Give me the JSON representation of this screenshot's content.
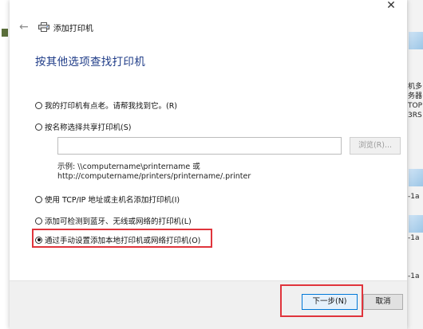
{
  "window": {
    "close_glyph": "✕",
    "back_glyph": "←",
    "title": "添加打印机",
    "heading": "按其他选项查找打印机"
  },
  "options": [
    {
      "label": "我的打印机有点老。请帮我找到它。(R)",
      "checked": false
    },
    {
      "label": "按名称选择共享打印机(S)",
      "checked": false
    },
    {
      "label": "使用 TCP/IP 地址或主机名添加打印机(I)",
      "checked": false
    },
    {
      "label": "添加可检测到蓝牙、无线或网络的打印机(L)",
      "checked": false
    },
    {
      "label": "通过手动设置添加本地打印机或网络打印机(O)",
      "checked": true
    }
  ],
  "share": {
    "input_value": "",
    "browse_label": "浏览(R)...",
    "example_line1": "示例: \\\\computername\\printername 或",
    "example_line2": "http://computername/printers/printername/.printer"
  },
  "buttons": {
    "next": "下一步(N)",
    "cancel": "取消"
  },
  "background": {
    "right_texts": [
      "机多",
      "务器",
      "TOP",
      "3RS",
      "-1a",
      "-1a",
      "-1a"
    ]
  },
  "colors": {
    "heading": "#1f3c88",
    "highlight": "#e0343c",
    "primary_button_border": "#0078d7"
  },
  "icons": {
    "printer": "printer-icon",
    "back": "back-arrow-icon",
    "close": "close-icon"
  }
}
